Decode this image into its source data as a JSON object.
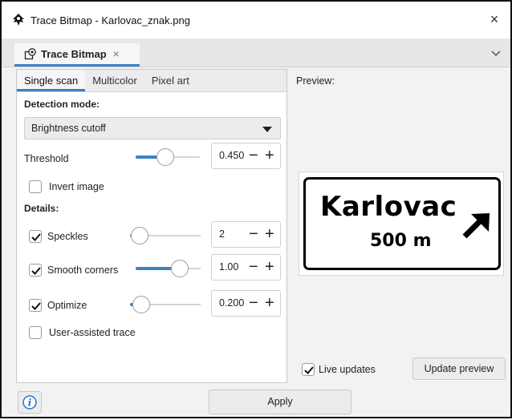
{
  "window": {
    "title": "Trace Bitmap - Karlovac_znak.png",
    "close_glyph": "×",
    "icon": "inkscape-icon"
  },
  "doc_tab": {
    "label": "Trace Bitmap",
    "close_glyph": "×",
    "icon": "trace-bitmap-icon",
    "more_icon": "chevron-down-icon"
  },
  "subtabs": [
    {
      "label": "Single scan",
      "active": true
    },
    {
      "label": "Multicolor",
      "active": false
    },
    {
      "label": "Pixel art",
      "active": false
    }
  ],
  "detection": {
    "heading": "Detection mode:",
    "selected": "Brightness cutoff"
  },
  "threshold": {
    "label": "Threshold",
    "value": "0.450",
    "level": 0.45,
    "minus": "−",
    "plus": "+"
  },
  "invert": {
    "label": "Invert image",
    "checked": false
  },
  "details": {
    "heading": "Details:",
    "speckles": {
      "label": "Speckles",
      "checked": true,
      "value": "2",
      "level": 0.02
    },
    "smooth": {
      "label": "Smooth corners",
      "checked": true,
      "value": "1.00",
      "level": 0.75
    },
    "optimize": {
      "label": "Optimize",
      "checked": true,
      "value": "0.200",
      "level": 0.04
    },
    "user_assisted": {
      "label": "User-assisted trace",
      "checked": false
    },
    "minus": "−",
    "plus": "+"
  },
  "preview": {
    "label": "Preview:",
    "sign_city": "Karlovac",
    "sign_distance": "500 m",
    "live_updates_label": "Live updates",
    "live_updates_checked": true,
    "update_button": "Update preview"
  },
  "footer": {
    "apply_label": "Apply",
    "info_icon": "info-icon"
  },
  "colors": {
    "accent": "#3b82c4",
    "panel_bg": "#f2f2f2"
  }
}
